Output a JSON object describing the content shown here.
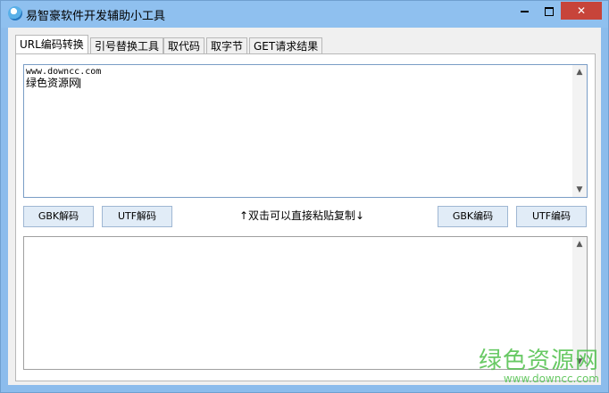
{
  "window": {
    "title": "易智豪软件开发辅助小工具",
    "minimize_label": "",
    "maximize_label": "",
    "close_label": "✕"
  },
  "tabs": [
    {
      "label": "URL编码转换",
      "active": true
    },
    {
      "label": "引号替换工具",
      "active": false
    },
    {
      "label": "取代码",
      "active": false
    },
    {
      "label": "取字节",
      "active": false
    },
    {
      "label": "GET请求结果",
      "active": false
    }
  ],
  "input_box": {
    "line1": "www.downcc.com",
    "line2": "绿色资源网"
  },
  "output_box": {
    "value": ""
  },
  "buttons": {
    "gbk_decode": "GBK解码",
    "utf_decode": "UTF解码",
    "gbk_encode": "GBK编码",
    "utf_encode": "UTF编码"
  },
  "hint": "↑双击可以直接粘贴复制↓",
  "watermark": {
    "name": "绿色资源网",
    "url": "www.downcc.com"
  },
  "colors": {
    "title_bar": "#8fc0ef",
    "close_button": "#c7443a",
    "watermark": "#4ec04a"
  }
}
